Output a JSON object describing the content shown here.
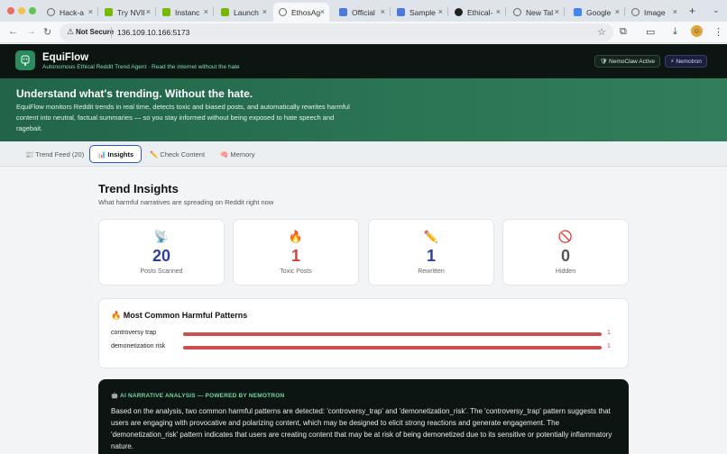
{
  "browser": {
    "tabs": [
      {
        "label": "Hack-a",
        "fav": "globe-icon",
        "color": "#666666"
      },
      {
        "label": "Try NVIl",
        "fav": "nvidia-icon",
        "color": "#76b900"
      },
      {
        "label": "Instanc",
        "fav": "nvidia-icon",
        "color": "#76b900"
      },
      {
        "label": "Launch",
        "fav": "nvidia-icon",
        "color": "#76b900"
      },
      {
        "label": "EthosAg",
        "fav": "globe-icon",
        "color": "#666666",
        "active": true
      },
      {
        "label": "Official",
        "fav": "doc-icon",
        "color": "#4a7ae0"
      },
      {
        "label": "Sample",
        "fav": "doc-icon",
        "color": "#4a7ae0"
      },
      {
        "label": "Ethical-",
        "fav": "github-icon",
        "color": "#222222"
      },
      {
        "label": "New Tal",
        "fav": "globe-icon",
        "color": "#666666"
      },
      {
        "label": "Google",
        "fav": "google-icon",
        "color": "#4285f4"
      },
      {
        "label": "Image",
        "fav": "globe-icon",
        "color": "#666666"
      }
    ],
    "security_label": "Not Secure",
    "url": "136.109.10.166:5173"
  },
  "app": {
    "name": "EquiFlow",
    "tagline": "Autonomous Ethical Reddit Trend Agent · Read the internet without the hate",
    "badge_nemoclaw": "🛡 NemoClaw Active",
    "badge_nemotron": "⚡ Nemotron"
  },
  "hero": {
    "title": "Understand what's trending. Without the hate.",
    "body": "EquiFlow monitors Reddit trends in real time, detects toxic and biased posts, and automatically rewrites harmful content into neutral, factual summaries — so you stay informed without being exposed to hate speech and ragebait."
  },
  "tabs": [
    {
      "label": "📰 Trend Feed (20)"
    },
    {
      "label": "📊 Insights",
      "active": true
    },
    {
      "label": "✏️ Check Content"
    },
    {
      "label": "🧠 Memory"
    }
  ],
  "insights": {
    "title": "Trend Insights",
    "subtitle": "What harmful narratives are spreading on Reddit right now",
    "stats": [
      {
        "icon": "📡",
        "value": "20",
        "label": "Posts Scanned",
        "color": "#2f3fa5"
      },
      {
        "icon": "🔥",
        "value": "1",
        "label": "Toxic Posts",
        "color": "#d0433f"
      },
      {
        "icon": "✏️",
        "value": "1",
        "label": "Rewritten",
        "color": "#2f3fa5"
      },
      {
        "icon": "🚫",
        "value": "0",
        "label": "Hidden",
        "color": "#555555"
      }
    ],
    "patterns_title": "🔥 Most Common Harmful Patterns",
    "patterns": [
      {
        "label": "controversy trap",
        "count": "1",
        "fraction": 1.0
      },
      {
        "label": "demonetization risk",
        "count": "1",
        "fraction": 1.0
      }
    ]
  },
  "analysis": {
    "heading": "🤖 AI NARRATIVE ANALYSIS — POWERED BY NEMOTRON",
    "body": "Based on the analysis, two common harmful patterns are detected: 'controversy_trap' and 'demonetization_risk'. The 'controversy_trap' pattern suggests that users are engaging with provocative and polarizing content, which may be designed to elicit strong reactions and generate engagement. The 'demonetization_risk' pattern indicates that users are creating content that may be at risk of being demonetized due to its sensitive or potentially inflammatory nature."
  }
}
